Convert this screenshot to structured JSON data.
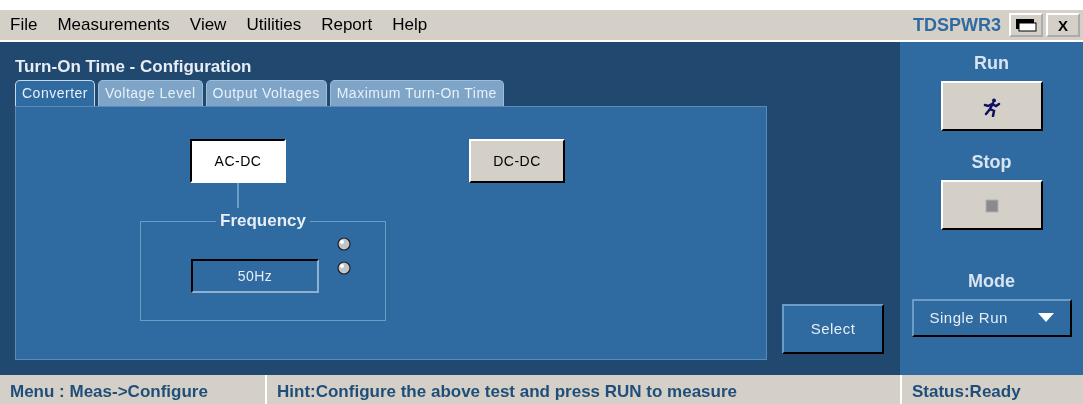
{
  "menu_bar": {
    "items": [
      "File",
      "Measurements",
      "View",
      "Utilities",
      "Report",
      "Help"
    ],
    "app_name": "TDSPWR3",
    "close_label": "X"
  },
  "panel": {
    "title": "Turn-On Time - Configuration",
    "tabs": [
      {
        "label": "Converter",
        "selected": true
      },
      {
        "label": "Voltage Level",
        "selected": false
      },
      {
        "label": "Output Voltages",
        "selected": false
      },
      {
        "label": "Maximum Turn-On Time",
        "selected": false
      }
    ],
    "converters": [
      {
        "label": "AC-DC",
        "selected": true
      },
      {
        "label": "DC-DC",
        "selected": false
      }
    ],
    "frequency": {
      "title": "Frequency",
      "value": "50Hz"
    },
    "select_label": "Select"
  },
  "side": {
    "run_title": "Run",
    "stop_title": "Stop",
    "mode_title": "Mode",
    "mode_value": "Single Run"
  },
  "status_bar": {
    "menu": "Menu : Meas->Configure",
    "hint": "Hint:Configure the above test and press RUN to measure",
    "status": "Status:Ready"
  }
}
